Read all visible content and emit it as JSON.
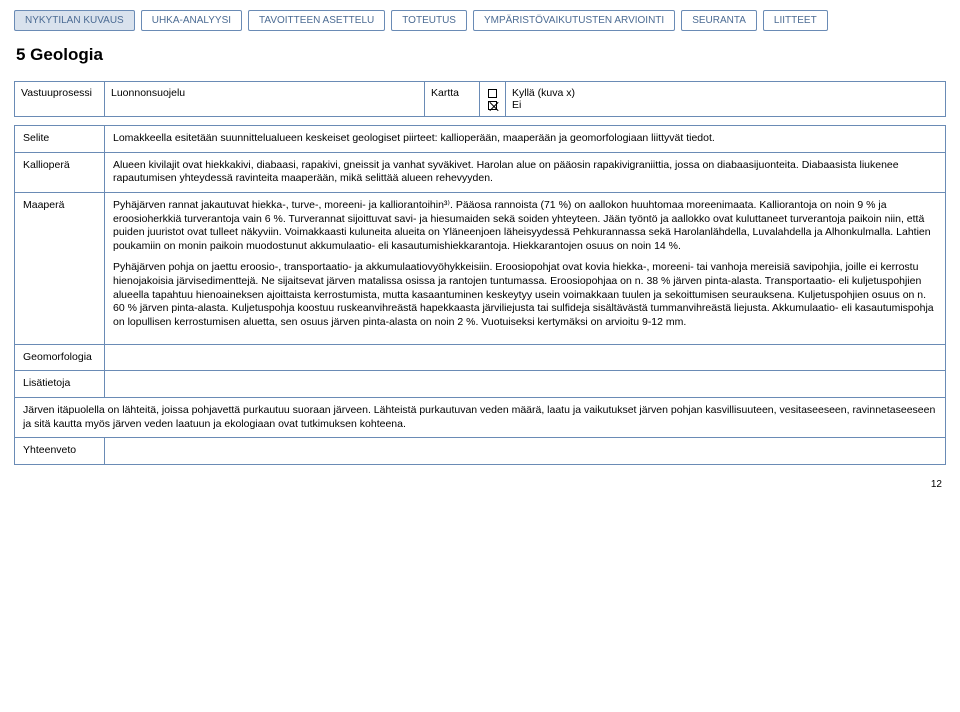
{
  "tabs": {
    "t0": "NYKYTILAN KUVAUS",
    "t1": "UHKA-ANALYYSI",
    "t2": "TAVOITTEEN ASETTELU",
    "t3": "TOTEUTUS",
    "t4": "YMPÄRISTÖVAIKUTUSTEN ARVIOINTI",
    "t5": "SEURANTA",
    "t6": "LIITTEET"
  },
  "section_title": "5 Geologia",
  "meta": {
    "vastuuprosessi_label": "Vastuuprosessi",
    "vastuuprosessi_value": "Luonnonsuojelu",
    "kartta_label": "Kartta",
    "kartta_opt_yes": "Kyllä (kuva x)",
    "kartta_opt_no": "Ei"
  },
  "rows": {
    "selite_label": "Selite",
    "selite_text": "Lomakkeella esitetään suunnittelualueen keskeiset geologiset piirteet: kallioperään, maaperään ja geomorfologiaan liittyvät tiedot.",
    "kalliopera_label": "Kallioperä",
    "kalliopera_text": "Alueen kivilajit ovat hiekkakivi, diabaasi, rapakivi, gneissit ja vanhat syväkivet. Harolan alue on pääosin rapakivigraniittia, jossa on diabaasijuonteita. Diabaasista liukenee rapautumisen yhteydessä ravinteita maaperään, mikä selittää alueen rehevyyden.",
    "maapera_label": "Maaperä",
    "maapera_p1": "Pyhäjärven rannat jakautuvat hiekka-, turve-, moreeni- ja kalliorantoihin³⁾. Pääosa rannoista (71 %) on aallokon huuhtomaa moreenimaata. Kalliorantoja on noin 9 % ja eroosioherkkiä turverantoja vain 6 %. Turverannat sijoittuvat savi- ja hiesumaiden sekä soiden yhteyteen. Jään työntö ja aallokko ovat kuluttaneet turverantoja paikoin niin, että puiden juuristot ovat tulleet näkyviin. Voimakkaasti kuluneita alueita on Yläneenjoen läheisyydessä Pehkurannassa sekä Harolanlähdella, Luvalahdella ja Alhonkulmalla. Lahtien poukamiin on monin paikoin muodostunut akkumulaatio- eli kasautumishiekkarantoja. Hiekkarantojen osuus on noin 14 %.",
    "maapera_p2": "Pyhäjärven pohja on jaettu eroosio-, transportaatio- ja akkumulaatiovyöhykkeisiin. Eroosiopohjat ovat kovia hiekka-, moreeni- tai vanhoja mereisiä savipohjia, joille ei kerrostu hienojakoisia järvisedimenttejä. Ne sijaitsevat järven matalissa osissa ja rantojen tuntumassa. Eroosiopohjaa on n. 38 % järven pinta-alasta. Transportaatio- eli kuljetuspohjien alueella tapahtuu hienoaineksen ajoittaista kerrostumista, mutta kasaantuminen keskeytyy usein voimakkaan tuulen ja sekoittumisen seurauksena. Kuljetuspohjien osuus on n. 60 % järven pinta-alasta. Kuljetuspohja koostuu ruskeanvihreästä hapekkaasta järviliejusta tai sulfideja sisältävästä tummanvihreästä liejusta. Akkumulaatio- eli kasautumispohja on lopullisen kerrostumisen aluetta, sen osuus järven pinta-alasta on noin 2 %. Vuotuiseksi kertymäksi on arvioitu 9-12 mm.",
    "geomorf_label": "Geomorfologia",
    "lisat_label": "Lisätietoja",
    "lisat_text": "Järven itäpuolella on lähteitä, joissa pohjavettä purkautuu suoraan järveen. Lähteistä purkautuvan veden määrä, laatu ja vaikutukset järven pohjan kasvillisuuteen, vesitaseeseen, ravinnetaseeseen ja sitä kautta myös järven veden laatuun ja ekologiaan ovat tutkimuksen kohteena.",
    "yhteenveto_label": "Yhteenveto"
  },
  "pagenum": "12"
}
